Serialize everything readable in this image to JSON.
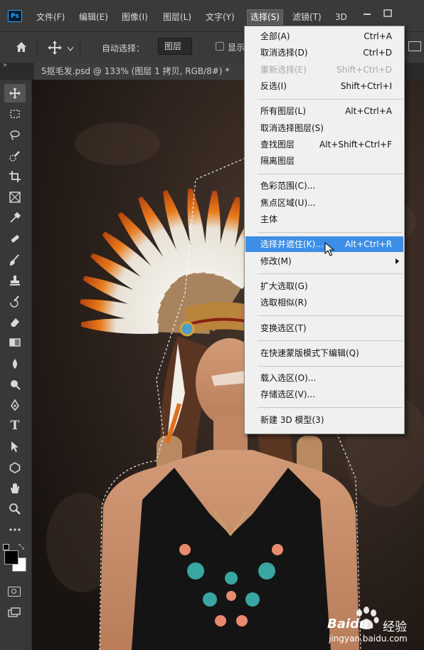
{
  "app": {
    "logo": "Ps",
    "menu": [
      "文件(F)",
      "编辑(E)",
      "图像(I)",
      "图层(L)",
      "文字(Y)",
      "选择(S)",
      "滤镜(T)",
      "3D"
    ],
    "active_menu": "选择(S)"
  },
  "options_bar": {
    "auto_select_label": "自动选择：",
    "auto_select_checked": true,
    "layer_select_value": "图层",
    "show_label": "显示"
  },
  "document": {
    "tab_title": "5抠毛发.psd @ 133% (图层 1 拷贝, RGB/8#) *"
  },
  "select_menu": {
    "groups": [
      [
        {
          "label": "全部(A)",
          "shortcut": "Ctrl+A"
        },
        {
          "label": "取消选择(D)",
          "shortcut": "Ctrl+D"
        },
        {
          "label": "重新选择(E)",
          "shortcut": "Shift+Ctrl+D",
          "disabled": true
        },
        {
          "label": "反选(I)",
          "shortcut": "Shift+Ctrl+I"
        }
      ],
      [
        {
          "label": "所有图层(L)",
          "shortcut": "Alt+Ctrl+A"
        },
        {
          "label": "取消选择图层(S)",
          "shortcut": ""
        },
        {
          "label": "查找图层",
          "shortcut": "Alt+Shift+Ctrl+F"
        },
        {
          "label": "隔离图层",
          "shortcut": ""
        }
      ],
      [
        {
          "label": "色彩范围(C)...",
          "shortcut": ""
        },
        {
          "label": "焦点区域(U)...",
          "shortcut": ""
        },
        {
          "label": "主体",
          "shortcut": ""
        }
      ],
      [
        {
          "label": "选择并遮住(K)...",
          "shortcut": "Alt+Ctrl+R",
          "highlight": true
        },
        {
          "label": "修改(M)",
          "shortcut": "",
          "submenu": true
        }
      ],
      [
        {
          "label": "扩大选取(G)",
          "shortcut": ""
        },
        {
          "label": "选取相似(R)",
          "shortcut": ""
        }
      ],
      [
        {
          "label": "变换选区(T)",
          "shortcut": ""
        }
      ],
      [
        {
          "label": "在快速蒙版模式下编辑(Q)",
          "shortcut": ""
        }
      ],
      [
        {
          "label": "载入选区(O)...",
          "shortcut": ""
        },
        {
          "label": "存储选区(V)...",
          "shortcut": ""
        }
      ],
      [
        {
          "label": "新建 3D 模型(3)",
          "shortcut": ""
        }
      ]
    ]
  },
  "toolbar": {
    "tools": [
      "move-tool",
      "marquee-tool",
      "lasso-tool",
      "quick-select-tool",
      "crop-tool",
      "frame-tool",
      "eyedropper-tool",
      "healing-brush-tool",
      "brush-tool",
      "stamp-tool",
      "history-brush-tool",
      "eraser-tool",
      "gradient-tool",
      "blur-tool",
      "dodge-tool",
      "pen-tool",
      "type-tool",
      "path-select-tool",
      "shape-tool",
      "hand-tool",
      "zoom-tool",
      "more-tools"
    ],
    "type_tool_glyph": "T"
  },
  "colors": {
    "menu_highlight": "#3d8ee6",
    "ui_dark": "#3a3a3a",
    "ps_blue": "#2fa3f6"
  },
  "watermark": {
    "brand": "Baidu",
    "brand_cn": "经验",
    "url": "jingyan.baidu.com"
  }
}
